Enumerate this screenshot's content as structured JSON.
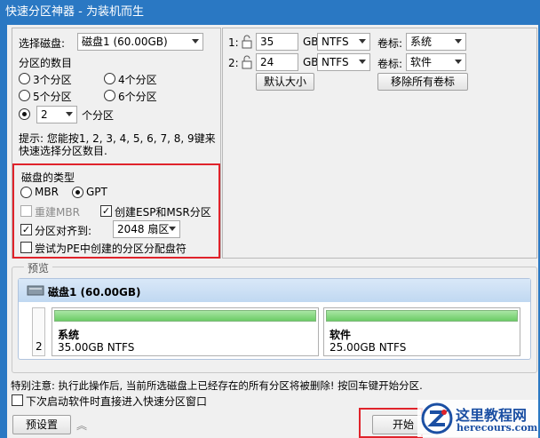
{
  "window": {
    "title": "快速分区神器 - 为装机而生"
  },
  "left": {
    "select_disk_label": "选择磁盘:",
    "disk_selected": "磁盘1 (60.00GB)",
    "count_label": "分区的数目",
    "opt3": "3个分区",
    "opt4": "4个分区",
    "opt5": "5个分区",
    "opt6": "6个分区",
    "custom_count": "2",
    "custom_suffix": "个分区",
    "hint_line1": "提示: 您能按1, 2, 3, 4, 5, 6, 7, 8, 9键来",
    "hint_line2": "快速选择分区数目."
  },
  "disktype": {
    "label": "磁盘的类型",
    "mbr": "MBR",
    "gpt": "GPT",
    "rebuild_mbr": "重建MBR",
    "create_esp": "创建ESP和MSR分区",
    "align_label": "分区对齐到:",
    "align_value": "2048 扇区",
    "try_pe": "尝试为PE中创建的分区分配盘符"
  },
  "right": {
    "rows": [
      {
        "index": "1:",
        "size": "35",
        "unit": "GB",
        "fs": "NTFS",
        "label_caption": "卷标:",
        "label": "系统"
      },
      {
        "index": "2:",
        "size": "24",
        "unit": "GB",
        "fs": "NTFS",
        "label_caption": "卷标:",
        "label": "软件"
      }
    ],
    "default_size_btn": "默认大小",
    "remove_labels_btn": "移除所有卷标"
  },
  "preview": {
    "label": "预览",
    "disk_title": "磁盘1 (60.00GB)",
    "row_number": "2",
    "partitions": [
      {
        "name": "系统",
        "info": "35.00GB NTFS"
      },
      {
        "name": "软件",
        "info": "25.00GB NTFS"
      }
    ]
  },
  "bottom": {
    "warning": "特别注意: 执行此操作后, 当前所选磁盘上已经存在的所有分区将被删除! 按回车键开始分区.",
    "next_time": "下次启动软件时直接进入快速分区窗口",
    "preset_btn": "预设置",
    "start_btn": "开始"
  },
  "watermark": {
    "name": "这里教程网",
    "url": "herecours.com"
  },
  "colors": {
    "title": "#2a78c3",
    "partition_bar": "#7fd67a",
    "highlight": "#e0232b"
  }
}
